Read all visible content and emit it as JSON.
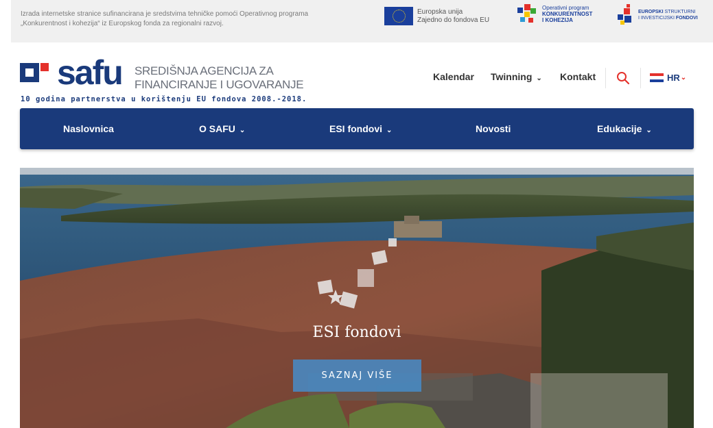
{
  "topbar": {
    "notice_line1": "Izrada internetske stranice sufinancirana je sredstvima tehničke pomoći Operativnog programa",
    "notice_line2": "„Konkurentnost i kohezija“ iz Europskog fonda za regionalni razvoj.",
    "eu_line1": "Europska unija",
    "eu_line2": "Zajedno do fondova EU",
    "op_line1": "Operativni program",
    "op_line2": "KONKURENTNOST",
    "op_line3": "I KOHEZIJA",
    "esi_line1a": "EUROPSKI",
    "esi_line1b": "STRUKTURNI",
    "esi_line2a": "I INVESTICIJSKI",
    "esi_line2b": "FONDOVI"
  },
  "brand": {
    "logo_text": "safu",
    "agency_line1": "SREDIŠNJA AGENCIJA ZA",
    "agency_line2": "FINANCIRANJE I UGOVARANJE",
    "tagline": "10 godina partnerstva u korištenju EU fondova 2008.-2018."
  },
  "topnav": {
    "calendar": "Kalendar",
    "twinning": "Twinning",
    "contact": "Kontakt",
    "language": "HR"
  },
  "mainnav": {
    "items": [
      "Naslovnica",
      "O SAFU",
      "ESI fondovi",
      "Novosti",
      "Edukacije"
    ]
  },
  "hero": {
    "title": "ESI fondovi",
    "button": "SAZNAJ VIŠE"
  },
  "colors": {
    "brand_blue": "#1a3a7b",
    "accent_red": "#e4312b",
    "button_blue": "#468cc8"
  },
  "icons": {
    "search": "search-icon",
    "chevron": "chevron-down-icon",
    "flag": "croatia-flag-icon"
  }
}
